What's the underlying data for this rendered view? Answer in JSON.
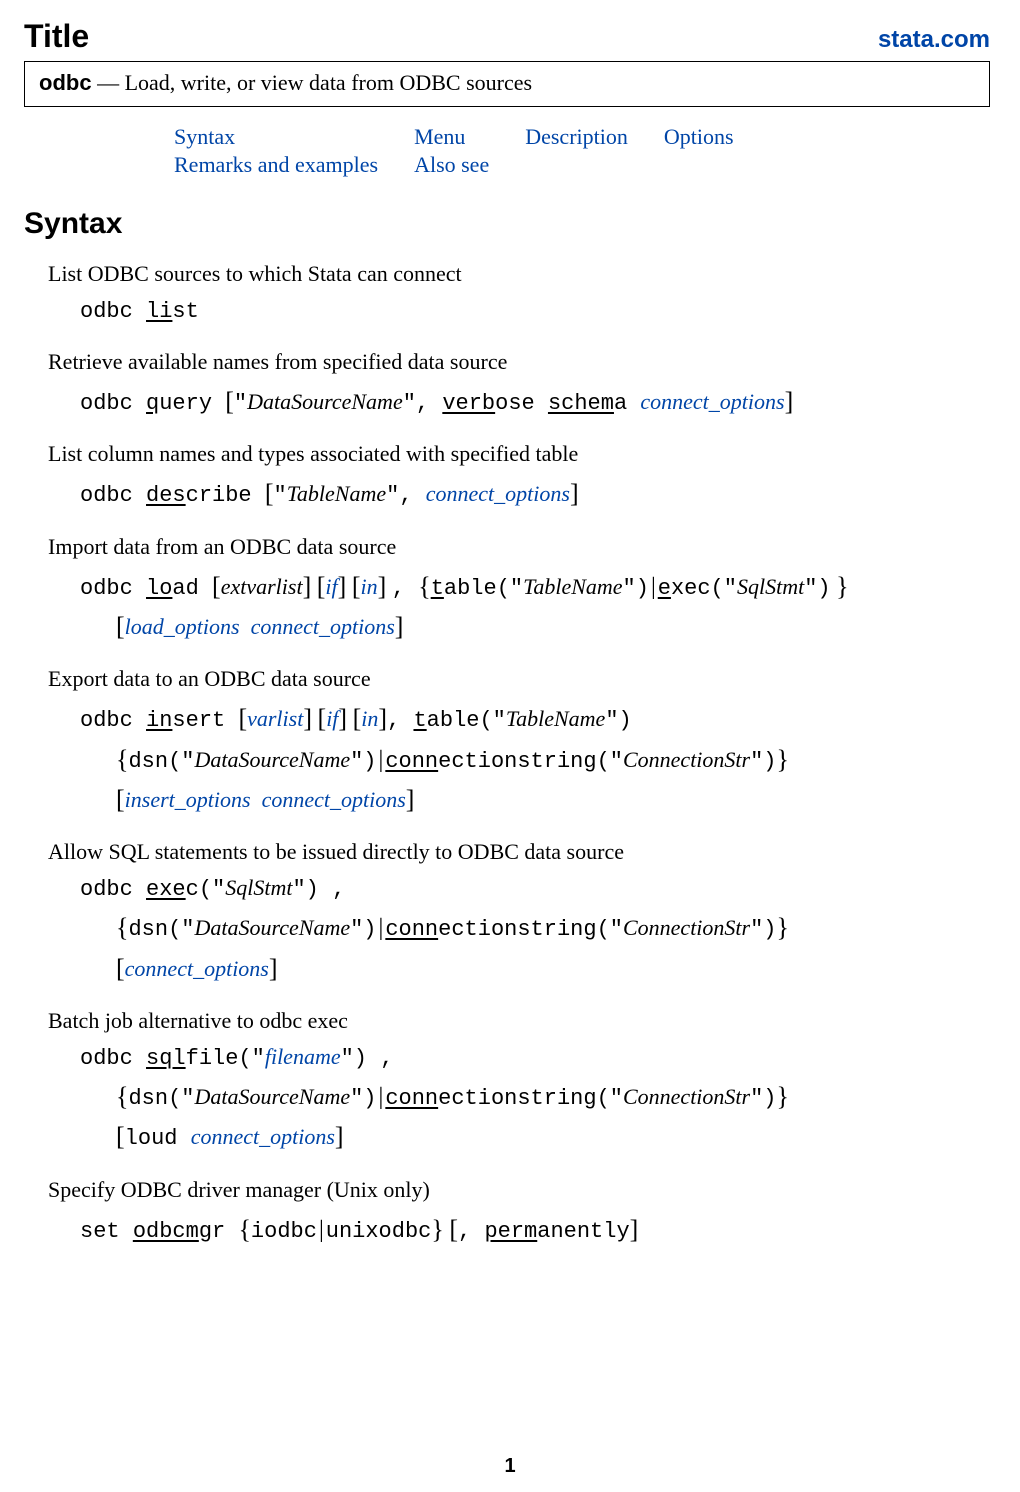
{
  "header": {
    "title": "Title",
    "stata_link": "stata.com"
  },
  "cmdbox": {
    "cmd": "odbc",
    "dash": " — ",
    "desc": "Load, write, or view data from ODBC sources"
  },
  "nav": {
    "r1c1": "Syntax",
    "r1c2": "Menu",
    "r1c3": "Description",
    "r1c4": "Options",
    "r2c1": "Remarks and examples",
    "r2c2": "Also see"
  },
  "sections": {
    "syntax_heading": "Syntax"
  },
  "syntax": {
    "list_desc": "List ODBC sources to which Stata can connect",
    "list_line": {
      "odbc": "odbc ",
      "li": "li",
      "st": "st"
    },
    "query_desc": "Retrieve available names from specified data source",
    "query_line": {
      "odbc": "odbc ",
      "q": "q",
      "uery": "uery ",
      "dsn": "DataSourceName",
      "comma": ", ",
      "verb": "verb",
      "ose": "ose ",
      "schem": "schem",
      "a": "a ",
      "connopt": "connect_options"
    },
    "describe_desc": "List column names and types associated with specified table",
    "describe_line": {
      "odbc": "odbc ",
      "des": "des",
      "cribe": "cribe ",
      "tname": "TableName",
      "comma": ", ",
      "connopt": "connect_options"
    },
    "load_desc": "Import data from an ODBC data source",
    "load_line": {
      "odbc": "odbc ",
      "lo": "lo",
      "ad": "ad ",
      "extv": "extvarlist",
      "if": "if",
      "in": "in",
      "comma": ", ",
      "t": "t",
      "able": "able(\"",
      "tname": "TableName",
      "cparen": "\")",
      "e": "e",
      "xec": "xec(\"",
      "sql": "SqlStmt",
      "cparen2": "\")",
      "loadopt": "load_options",
      "connopt": "connect_options"
    },
    "insert_desc": "Export data to an ODBC data source",
    "insert_line": {
      "odbc": "odbc ",
      "in": "in",
      "sert": "sert ",
      "varlist": "varlist",
      "if": "if",
      "inspec": "in",
      "comma": ", ",
      "t": "t",
      "able": "able(\"",
      "tname": "TableName",
      "cparen": "\")",
      "dsn": "dsn(\"",
      "dname": "DataSourceName",
      "cparen2": "\")",
      "conn": "conn",
      "ection": "ectionstring(\"",
      "cstr": "ConnectionStr",
      "cparen3": "\")",
      "insopt": "insert_options",
      "connopt": "connect_options"
    },
    "exec_desc": "Allow SQL statements to be issued directly to ODBC data source",
    "exec_line": {
      "odbc": "odbc ",
      "exe": "exe",
      "c": "c(\"",
      "sql": "SqlStmt",
      "cparen": "\") ,",
      "dsn": "dsn(\"",
      "dname": "DataSourceName",
      "cparen2": "\")",
      "conn": "conn",
      "ection": "ectionstring(\"",
      "cstr": "ConnectionStr",
      "cparen3": "\")",
      "connopt": "connect_options"
    },
    "sqlfile_desc": "Batch job alternative to odbc exec",
    "sqlfile_line": {
      "odbc": "odbc ",
      "sql": "sql",
      "file": "file(\"",
      "fname": "filename",
      "cparen": "\") ,",
      "dsn": "dsn(\"",
      "dname": "DataSourceName",
      "cparen2": "\")",
      "conn": "conn",
      "ection": "ectionstring(\"",
      "cstr": "ConnectionStr",
      "cparen3": "\")",
      "loud": "loud ",
      "connopt": "connect_options"
    },
    "odbcmgr_desc": "Specify ODBC driver manager (Unix only)",
    "odbcmgr_line": {
      "set": "set ",
      "odbcm": "odbcm",
      "gr": "gr ",
      "iodbc": "iodbc",
      "unixodbc": "unixodbc",
      "comma": ", ",
      "perm": "perm",
      "anently": "anently"
    }
  },
  "pagenum": "1"
}
